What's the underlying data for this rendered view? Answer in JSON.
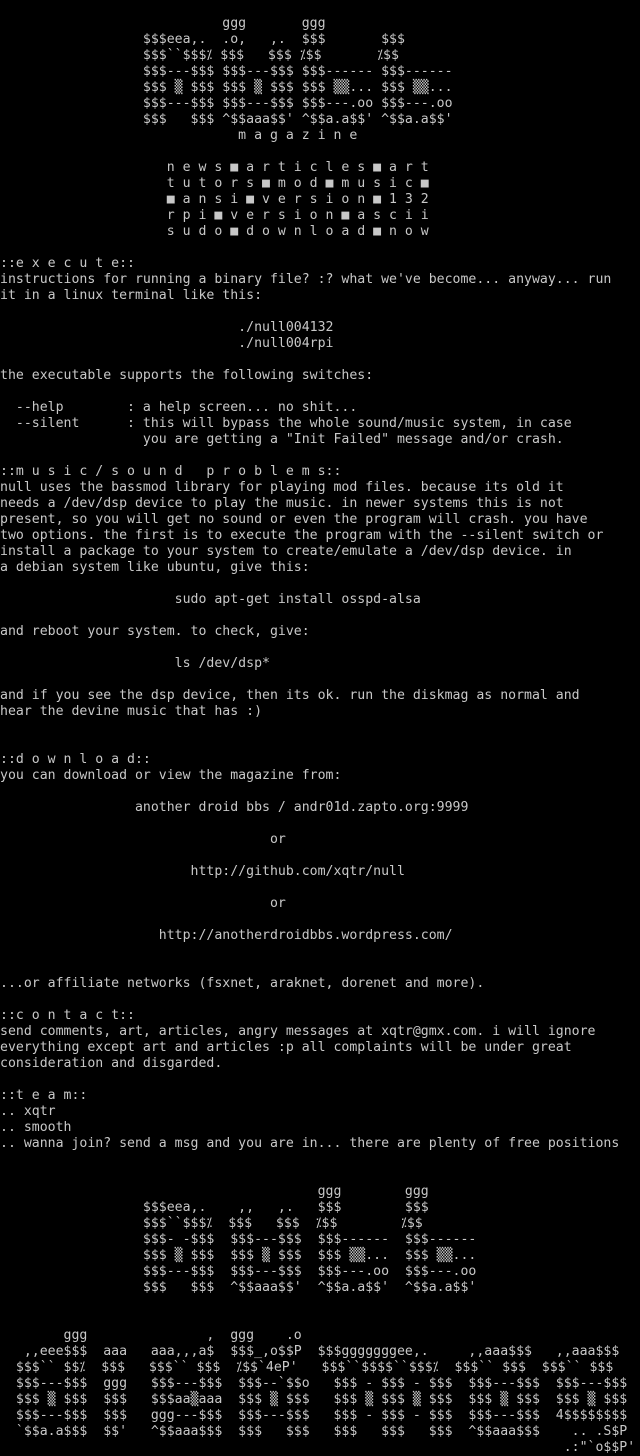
{
  "logo_top": [
    "                            ggg       ggg",
    "                  $$$eea,.  .o,   ,.  $$$       $$$",
    "                  $$$``$$$⁒ $$$   $$$ ⁒$$       ⁒$$",
    "                  $$$---$$$ $$$---$$$ $$$------ $$$------",
    "                  $$$ ▒ $$$ $$$ ▒ $$$ $$$ ▒▒... $$$ ▒▒...",
    "                  $$$---$$$ $$$---$$$ $$$---.oo $$$---.oo",
    "                  $$$   $$$ ^$$aaa$$' ^$$a.a$$' ^$$a.a$$'",
    "                              m a g a z i n e"
  ],
  "menu": [
    "                     n e w s ■ a r t i c l e s ■ a r t",
    "                     t u t o r s ■ m o d ■ m u s i c ■",
    "                     ■ a n s i ■ v e r s i o n ■ 1 3 2",
    "                     r p i ■ v e r s i o n ■ a s c i i",
    "                     s u d o ■ d o w n l o a d ■ n o w"
  ],
  "execute": [
    "::e x e c u t e::",
    "instructions for running a binary file? :? what we've become... anyway... run",
    "it in a linux terminal like this:",
    "",
    "                              ./null004132",
    "                              ./null004rpi",
    "",
    "the executable supports the following switches:",
    "",
    "  --help        : a help screen... no shit...",
    "  --silent      : this will bypass the whole sound/music system, in case",
    "                  you are getting a \"Init Failed\" message and/or crash.",
    ""
  ],
  "music": [
    "::m u s i c / s o u n d   p r o b l e m s::",
    "null uses the bassmod library for playing mod files. because its old it",
    "needs a /dev/dsp device to play the music. in newer systems this is not",
    "present, so you will get no sound or even the program will crash. you have",
    "two options. the first is to execute the program with the --silent switch or",
    "install a package to your system to create/emulate a /dev/dsp device. in",
    "a debian system like ubuntu, give this:",
    "",
    "                      sudo apt-get install osspd-alsa",
    "",
    "and reboot your system. to check, give:",
    "",
    "                      ls /dev/dsp*",
    "",
    "and if you see the dsp device, then its ok. run the diskmag as normal and",
    "hear the devine music that has :)",
    "",
    ""
  ],
  "download": {
    "heading": "::d o w n l o a d::",
    "intro": "you can download or view the magazine from:",
    "bbs": "                 another droid bbs / andr01d.zapto.org:9999",
    "or1": "                                  or",
    "github": "                        http://github.com/xqtr/null",
    "or2": "                                  or",
    "wordpress": "                    http://anotherdroidbbs.wordpress.com/",
    "affiliate": "...or affiliate networks (fsxnet, araknet, dorenet and more)."
  },
  "contact": [
    "::c o n t a c t::",
    "send comments, art, articles, angry messages at xqtr@gmx.com. i will ignore",
    "everything except art and articles :p all complaints will be under great",
    "consideration and disgarded.",
    ""
  ],
  "team": [
    "::t e a m::",
    ".. xqtr",
    ".. smooth",
    ".. wanna join? send a msg and you are in... there are plenty of free positions"
  ],
  "logo_bottom": [
    "                                        ggg        ggg",
    "                  $$$eea,.    ,,   ,.   $$$        $$$",
    "                  $$$``$$$⁒  $$$   $$$  ⁒$$        ⁒$$",
    "                  $$$- -$$$  $$$---$$$  $$$------  $$$------",
    "                  $$$ ▒ $$$  $$$ ▒ $$$  $$$ ▒▒...  $$$ ▒▒...",
    "                  $$$---$$$  $$$---$$$  $$$---.oo  $$$---.oo",
    "                  $$$   $$$  ^$$aaa$$'  ^$$a.a$$'  ^$$a.a$$'"
  ],
  "logo_anotherdroid": [
    "        ggg               ,  ggg    .o",
    "   ,,eee$$$  aaa   aaa,,,a$  $$$_,o$$P  $$$gggggggee,.     ,,aaa$$$   ,,aaa$$$",
    "  $$$`` $$⁒  $$$   $$$`` $$$  ⁒$$`4eP'   $$$``$$$$``$$$⁒  $$$`` $$$  $$$`` $$$",
    "  $$$---$$$  ggg   $$$---$$$  $$$--`$$o   $$$ - $$$ - $$$  $$$---$$$  $$$---$$$",
    "  $$$ ▒ $$$  $$$   $$$aa▒aaa  $$$ ▒ $$$   $$$ ▒ $$$ ▒ $$$  $$$ ▒ $$$  $$$ ▒ $$$",
    "  $$$---$$$  $$$   ggg---$$$  $$$---$$$   $$$ - $$$ - $$$  $$$---$$$  4$$$$$$$$",
    "  `$$a.a$$$  $$'   ^$$aaa$$$  $$$   $$$   $$$   $$$   $$$  ^$$aaa$$$    .. .S$P",
    "                                                                       .:\"`o$$P'"
  ]
}
